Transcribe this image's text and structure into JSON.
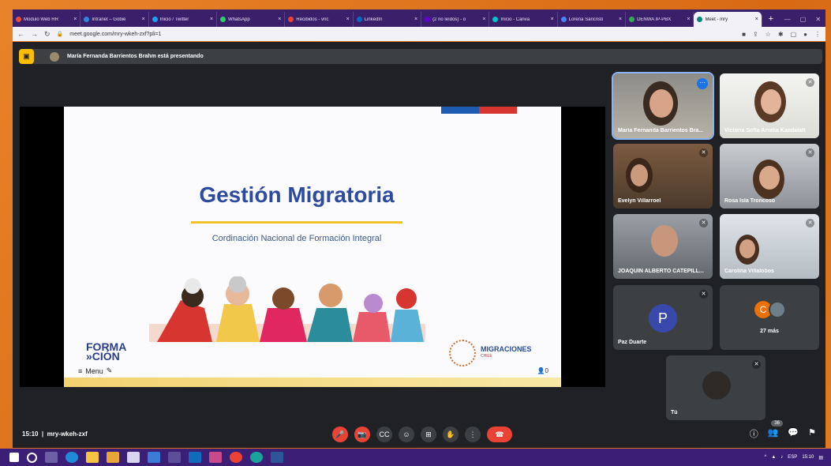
{
  "browser": {
    "tabs": [
      {
        "label": "Modulo Web RR",
        "color": "#e74c3c"
      },
      {
        "label": "Intranet – Gobie",
        "color": "#2e86de"
      },
      {
        "label": "Inicio / Twitter",
        "color": "#1da1f2"
      },
      {
        "label": "WhatsApp",
        "color": "#25d366"
      },
      {
        "label": "Recibidos - vric",
        "color": "#ea4335"
      },
      {
        "label": "LinkedIn",
        "color": "#0a66c2"
      },
      {
        "label": "(2 no leídos) - o",
        "color": "#6001d2"
      },
      {
        "label": "Inicio - Canva",
        "color": "#00c4cc"
      },
      {
        "label": "Lorena Sancristi",
        "color": "#4285f4"
      },
      {
        "label": "DENWA IP-PBX",
        "color": "#34a853"
      },
      {
        "label": "Meet - mry",
        "color": "#00897b",
        "active": true
      }
    ],
    "new_tab": "+",
    "url": "meet.google.com/mry-wkeh-zxf?pli=1"
  },
  "meet": {
    "presenting_banner": "María Fernanda Barrientos Brahm está presentando",
    "slide": {
      "title": "Gestión Migratoria",
      "subtitle": "Cordinación Nacional de Formación Integral",
      "logo_left_line1": "FORMA",
      "logo_left_line2": "»CIÓN",
      "menu_label": "Menu",
      "logo_right_line1": "MIGRACIONES",
      "logo_right_line2": "CHILE",
      "viewer_count": "0"
    },
    "participants": [
      {
        "name": "María Fernanda Barrientos Bra...",
        "highlighted": true
      },
      {
        "name": "Victoria Sofía Arratia Kandalaft"
      },
      {
        "name": "Evelyn Villarroel"
      },
      {
        "name": "Rosa Isla Troncoso"
      },
      {
        "name": "JOAQUIN ALBERTO CATEPILL..."
      },
      {
        "name": "Carolina Villalobos"
      },
      {
        "name": "Paz Duarte",
        "initial": "P"
      },
      {
        "name": "",
        "initial": "C",
        "more": "27 más"
      },
      {
        "name": "Tú"
      }
    ],
    "meeting_time": "15:10",
    "meeting_code": "mry-wkeh-zxf",
    "people_count": "36"
  },
  "taskbar": {
    "language": "ESP",
    "time": "15:10"
  }
}
